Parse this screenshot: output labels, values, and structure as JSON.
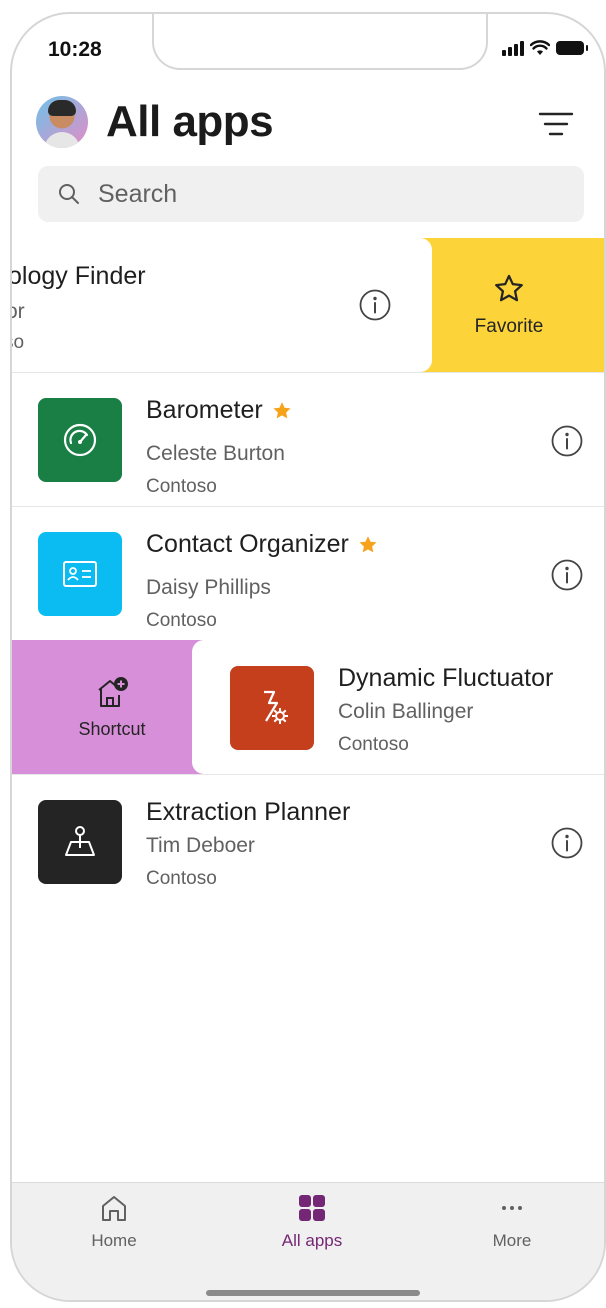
{
  "status_bar": {
    "time": "10:28"
  },
  "header": {
    "title": "All apps"
  },
  "search": {
    "placeholder": "Search"
  },
  "apps": [
    {
      "name": "Technology Finder",
      "name_visible": "ology Finder",
      "owner_visible": "or",
      "env_visible": "so",
      "favorite": false,
      "swipe_action": "Favorite"
    },
    {
      "name": "Barometer",
      "owner": "Celeste Burton",
      "env": "Contoso",
      "favorite": true,
      "icon": "gauge-icon",
      "color": "#1a7f45"
    },
    {
      "name": "Contact Organizer",
      "owner": "Daisy Phillips",
      "env": "Contoso",
      "favorite": true,
      "icon": "contact-card-icon",
      "color": "#0bbcf2"
    },
    {
      "name": "Dynamic Fluctuator",
      "owner": "Colin Ballinger",
      "env": "Contoso",
      "favorite": false,
      "icon": "flash-settings-icon",
      "color": "#c53f1c",
      "swipe_action": "Shortcut"
    },
    {
      "name": "Extraction Planner",
      "owner": "Tim Deboer",
      "env": "Contoso",
      "favorite": false,
      "icon": "map-pin-icon",
      "color": "#242424"
    }
  ],
  "actions": {
    "favorite_label": "Favorite",
    "shortcut_label": "Shortcut"
  },
  "tabs": [
    {
      "label": "Home",
      "icon": "home-icon",
      "active": false
    },
    {
      "label": "All apps",
      "icon": "grid-icon",
      "active": true
    },
    {
      "label": "More",
      "icon": "more-icon",
      "active": false
    }
  ],
  "colors": {
    "accent": "#742774",
    "favorite_swipe": "#fcd43a",
    "shortcut_swipe": "#d88fd9",
    "star": "#f7a21b"
  }
}
